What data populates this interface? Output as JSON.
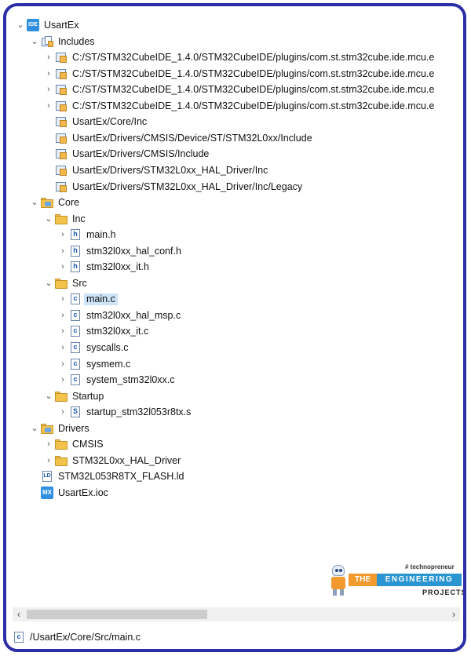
{
  "tree": {
    "project": {
      "label": "UsartEx",
      "icon": "project-icon",
      "expanded": true
    },
    "includes": {
      "label": "Includes",
      "expanded": true,
      "items": [
        "C:/ST/STM32CubeIDE_1.4.0/STM32CubeIDE/plugins/com.st.stm32cube.ide.mcu.e",
        "C:/ST/STM32CubeIDE_1.4.0/STM32CubeIDE/plugins/com.st.stm32cube.ide.mcu.e",
        "C:/ST/STM32CubeIDE_1.4.0/STM32CubeIDE/plugins/com.st.stm32cube.ide.mcu.e",
        "C:/ST/STM32CubeIDE_1.4.0/STM32CubeIDE/plugins/com.st.stm32cube.ide.mcu.e",
        "UsartEx/Core/Inc",
        "UsartEx/Drivers/CMSIS/Device/ST/STM32L0xx/Include",
        "UsartEx/Drivers/CMSIS/Include",
        "UsartEx/Drivers/STM32L0xx_HAL_Driver/Inc",
        "UsartEx/Drivers/STM32L0xx_HAL_Driver/Inc/Legacy"
      ]
    },
    "core": {
      "label": "Core",
      "inc": {
        "label": "Inc",
        "files": [
          "main.h",
          "stm32l0xx_hal_conf.h",
          "stm32l0xx_it.h"
        ]
      },
      "src": {
        "label": "Src",
        "files": [
          "main.c",
          "stm32l0xx_hal_msp.c",
          "stm32l0xx_it.c",
          "syscalls.c",
          "sysmem.c",
          "system_stm32l0xx.c"
        ],
        "selected": "main.c"
      },
      "startup": {
        "label": "Startup",
        "files": [
          "startup_stm32l053r8tx.s"
        ]
      }
    },
    "drivers": {
      "label": "Drivers",
      "folders": [
        "CMSIS",
        "STM32L0xx_HAL_Driver"
      ]
    },
    "linker_file": "STM32L053R8TX_FLASH.ld",
    "ioc_file": "UsartEx.ioc",
    "project_icon_text": "IDE",
    "ioc_icon_text": "MX"
  },
  "watermark": {
    "tagline": "# technopreneur",
    "the": "THE",
    "engineering": "ENGINEERING",
    "projects": "PROJECTS"
  },
  "status_bar": {
    "path": "/UsartEx/Core/Src/main.c"
  },
  "colors": {
    "frame_border": "#2b2ea6",
    "selection": "#cde3f7",
    "folder": "#f3c24a",
    "accent_blue": "#2a95d0",
    "accent_orange": "#f29a2e"
  }
}
